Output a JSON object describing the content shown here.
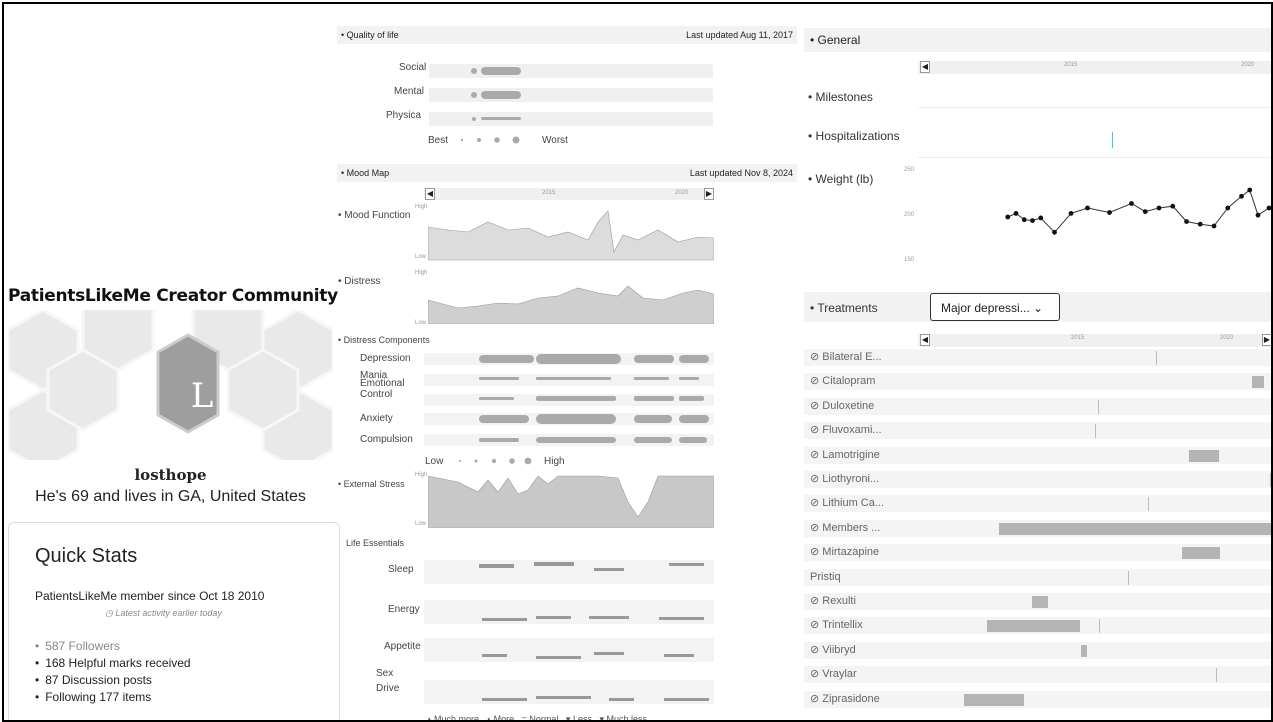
{
  "community_title": "PatientsLikeMe Creator Community",
  "avatar_letter": "L",
  "username": "losthope",
  "user_desc": "He's 69 and lives in GA, United States",
  "quick_stats": {
    "title": "Quick Stats",
    "since": "PatientsLikeMe member since Oct 18 2010",
    "latest": "Latest activity earlier today",
    "items": [
      "587 Followers",
      "168 Helpful marks received",
      "87 Discussion posts",
      "Following 177 items"
    ]
  },
  "qol": {
    "title": "Quality of life",
    "updated": "Last updated Aug 11, 2017",
    "rows": [
      "Social",
      "Mental",
      "Physica"
    ],
    "legend_best": "Best",
    "legend_worst": "Worst"
  },
  "mood": {
    "title": "Mood Map",
    "updated": "Last updated Nov 8, 2024",
    "mood_function": "Mood Function",
    "distress": "Distress",
    "high": "High",
    "low": "Low",
    "year_2015": "2015",
    "year_2020": "2020",
    "components_title": "Distress Components",
    "components": [
      "Depression",
      "Mania",
      "Emotional Control",
      "Anxiety",
      "Compulsion"
    ],
    "legend_low": "Low",
    "legend_high": "High",
    "external_stress": "External Stress",
    "life_essentials": "Life Essentials",
    "essentials": [
      "Sleep",
      "Energy",
      "Appetite",
      "Sex Drive"
    ],
    "bottom_legend": [
      "Much more",
      "More",
      "Normal",
      "Less",
      "Much less"
    ]
  },
  "general": {
    "title": "General",
    "year_2015": "2015",
    "year_2020": "2020",
    "milestones": "Milestones",
    "hospitalizations": "Hospitalizations",
    "weight": "Weight (lb)",
    "weight_ticks": [
      "250",
      "200",
      "150"
    ]
  },
  "treatments": {
    "title": "Treatments",
    "dropdown": "Major depressi...",
    "year_2015": "2015",
    "year_2020": "2020",
    "rows": [
      {
        "name": "Bilateral E...",
        "icon": true
      },
      {
        "name": "Citalopram",
        "icon": true
      },
      {
        "name": "Duloxetine",
        "icon": true
      },
      {
        "name": "Fluvoxami...",
        "icon": true
      },
      {
        "name": "Lamotrigine",
        "icon": true
      },
      {
        "name": "Liothyroni...",
        "icon": true
      },
      {
        "name": "Lithium Ca...",
        "icon": true
      },
      {
        "name": "Members ...",
        "icon": true
      },
      {
        "name": "Mirtazapine",
        "icon": true
      },
      {
        "name": "Pristiq",
        "icon": false
      },
      {
        "name": "Rexulti",
        "icon": true
      },
      {
        "name": "Trintellix",
        "icon": true
      },
      {
        "name": "Viibryd",
        "icon": true
      },
      {
        "name": "Vraylar",
        "icon": true
      },
      {
        "name": "Ziprasidone",
        "icon": true
      }
    ]
  },
  "weight_series": [
    [
      0.05,
      200
    ],
    [
      0.08,
      204
    ],
    [
      0.11,
      197
    ],
    [
      0.14,
      196
    ],
    [
      0.17,
      199
    ],
    [
      0.22,
      183
    ],
    [
      0.28,
      204
    ],
    [
      0.34,
      210
    ],
    [
      0.42,
      205
    ],
    [
      0.5,
      215
    ],
    [
      0.55,
      206
    ],
    [
      0.6,
      210
    ],
    [
      0.65,
      212
    ],
    [
      0.7,
      195
    ],
    [
      0.75,
      192
    ],
    [
      0.8,
      190
    ],
    [
      0.85,
      210
    ],
    [
      0.9,
      223
    ],
    [
      0.93,
      230
    ],
    [
      0.96,
      202
    ],
    [
      1.0,
      210
    ]
  ]
}
